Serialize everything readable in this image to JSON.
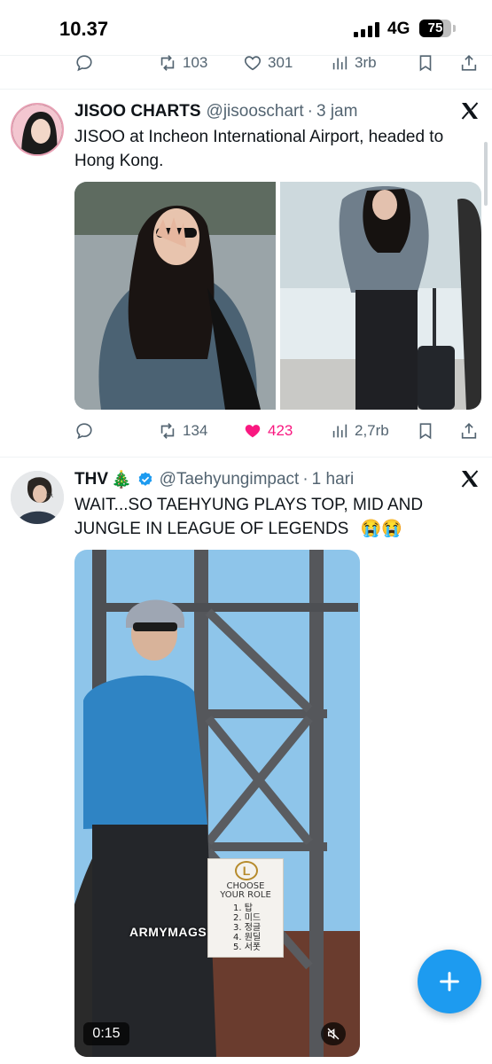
{
  "status_bar": {
    "time": "10.37",
    "network": "4G",
    "battery": "75",
    "battery_level": 0.75
  },
  "prev_tweet_actions": {
    "retweets": "103",
    "likes": "301",
    "views": "3rb"
  },
  "tweets": [
    {
      "name": "JISOO CHARTS",
      "handle": "@jisooschart",
      "dot": "·",
      "time": "3 jam",
      "text": "JISOO at Incheon International Airport, headed to Hong Kong.",
      "retweets": "134",
      "likes": "423",
      "views": "2,7rb",
      "liked": true
    },
    {
      "name": "THV",
      "name_emoji": "🎄",
      "verified": true,
      "handle": "@Taehyungimpact",
      "dot": "·",
      "time": "1 hari",
      "text": "WAIT...SO TAEHYUNG PLAYS TOP, MID AND JUNGLE IN LEAGUE OF LEGENDS",
      "text_emojis": "😭😭",
      "video": {
        "duration": "0:15",
        "watermark": "ARMYMAGS",
        "sign_title_1": "CHOOSE",
        "sign_title_2": "YOUR ROLE",
        "sign_items": [
          "1. 탑",
          "2. 미드",
          "3. 정글",
          "4. 원딜",
          "5. 서폿"
        ]
      }
    }
  ],
  "icons": {
    "reply": "reply-icon",
    "retweet": "retweet-icon",
    "like": "heart-icon",
    "views": "views-icon",
    "bookmark": "bookmark-icon",
    "share": "share-icon",
    "x_logo": "x-logo-icon",
    "compose": "plus-icon"
  },
  "colors": {
    "accent": "#1d9bf0",
    "like": "#f91880",
    "muted": "#536471"
  }
}
